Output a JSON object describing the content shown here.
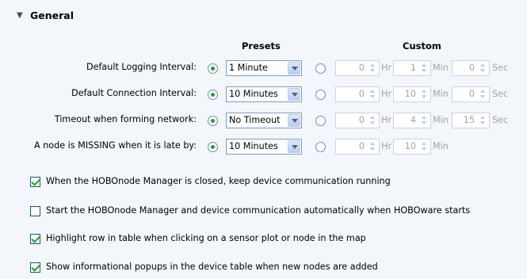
{
  "section": {
    "title": "General"
  },
  "headers": {
    "presets": "Presets",
    "custom": "Custom"
  },
  "rows": [
    {
      "label": "Default Logging Interval:",
      "preset": "1 Minute",
      "preset_selected": true,
      "hr": "0",
      "hr_unit": "Hr",
      "min": "1",
      "min_unit": "Min",
      "sec": "0",
      "sec_unit": "Sec"
    },
    {
      "label": "Default Connection Interval:",
      "preset": "10 Minutes",
      "preset_selected": true,
      "hr": "0",
      "hr_unit": "Hr",
      "min": "10",
      "min_unit": "Min",
      "sec": "0",
      "sec_unit": "Sec"
    },
    {
      "label": "Timeout when forming network:",
      "preset": "No Timeout",
      "preset_selected": true,
      "hr": "0",
      "hr_unit": "Hr",
      "min": "4",
      "min_unit": "Min",
      "sec": "15",
      "sec_unit": "Sec"
    },
    {
      "label": "A node is MISSING when it is late by:",
      "preset": "10 Minutes",
      "preset_selected": true,
      "hr": "0",
      "hr_unit": "Hr",
      "min": "10",
      "min_unit": "Min"
    }
  ],
  "options": [
    {
      "label": "When the HOBOnode Manager is closed, keep device communication running",
      "checked": true
    },
    {
      "label": "Start the HOBOnode Manager and device communication automatically when HOBOware starts",
      "checked": false
    },
    {
      "label": "Highlight row in table when clicking on a sensor plot or node in the map",
      "checked": true
    },
    {
      "label": "Show informational popups in the device table when new nodes are added",
      "checked": true
    }
  ]
}
